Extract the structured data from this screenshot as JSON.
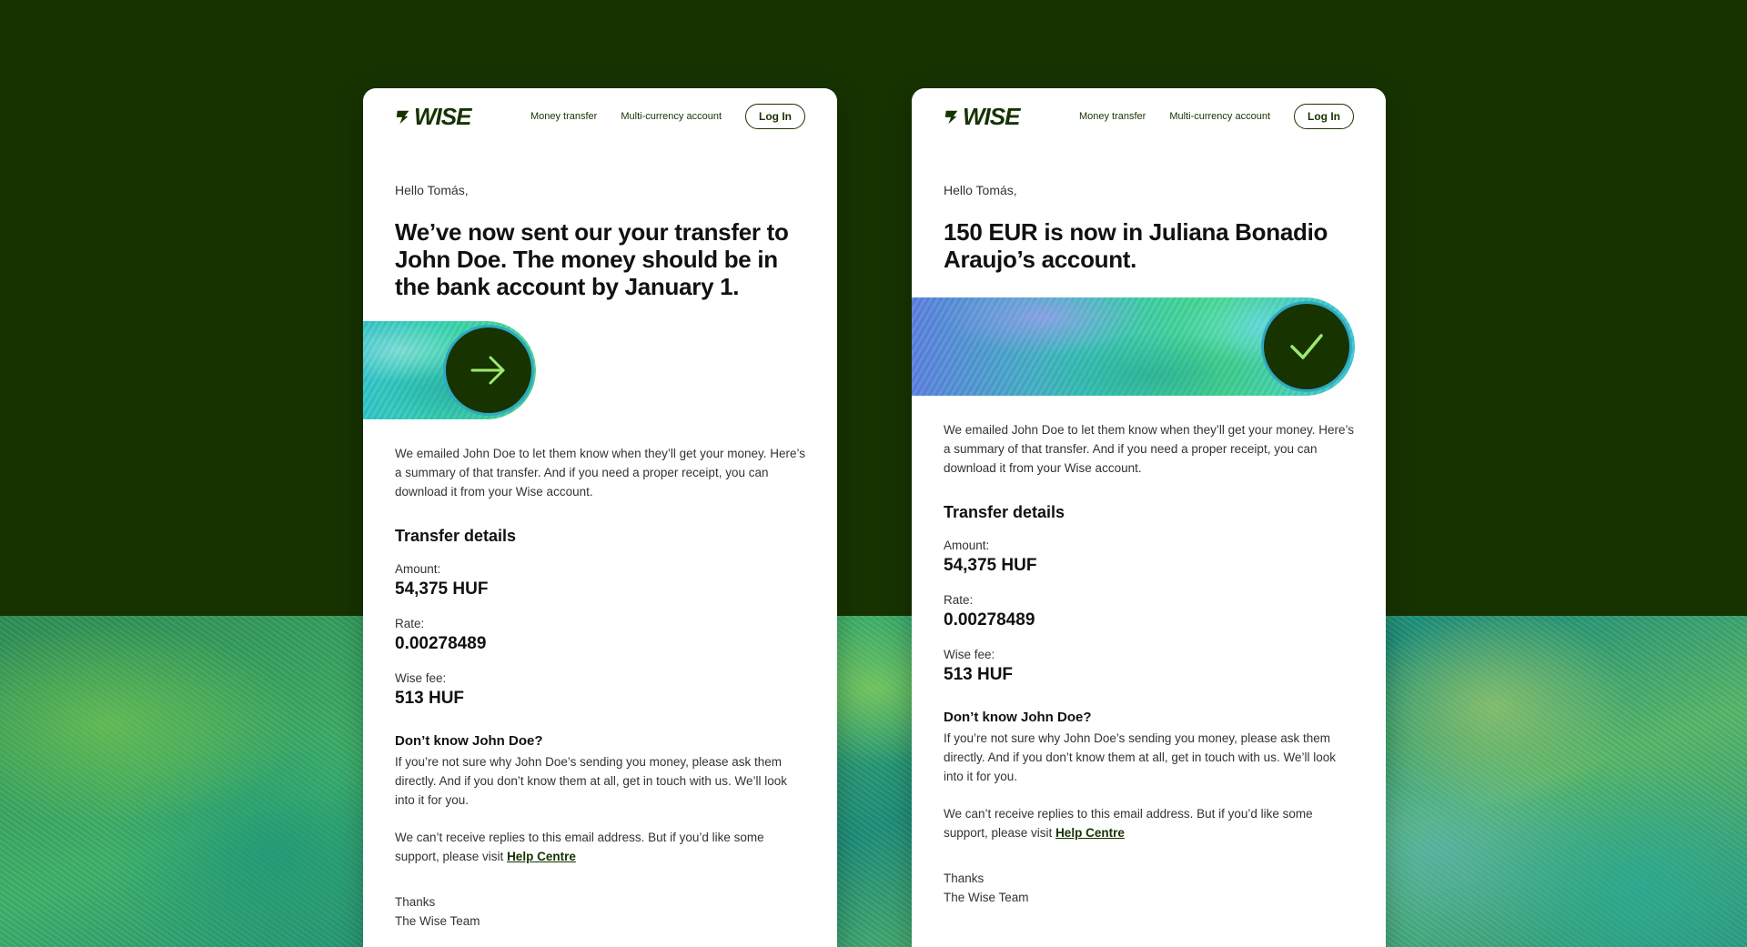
{
  "brand": {
    "logo_text": "WISE",
    "color": "#163300",
    "accent": "#9fe870"
  },
  "nav": {
    "links": [
      "Money transfer",
      "Multi-currency account"
    ],
    "login_label": "Log In"
  },
  "cards": [
    {
      "greeting": "Hello Tomás,",
      "headline": "We’ve now sent our your transfer to John Doe. The money should be in the bank account by January 1.",
      "status_icon": "arrow-right-icon",
      "intro": "We emailed John Doe to let them know when they’ll get your money. Here’s a summary of that transfer. And if you need a proper receipt, you can download it from your Wise account.",
      "details_title": "Transfer details",
      "details": [
        {
          "label": "Amount:",
          "value": "54,375 HUF"
        },
        {
          "label": "Rate:",
          "value": "0.00278489"
        },
        {
          "label": "Wise fee:",
          "value": "513 HUF"
        }
      ],
      "unknown_title": "Don’t know John Doe?",
      "unknown_text": "If you’re not sure why John Doe’s sending you money, please ask them directly. And if you don’t know them at all, get in touch with us. We’ll look into it for you.",
      "support_text": "We can’t receive replies to this email address. But if you’d like some support, please visit ",
      "support_link": "Help Centre",
      "thanks": "Thanks",
      "signature": "The Wise Team"
    },
    {
      "greeting": "Hello Tomás,",
      "headline": "150 EUR is now in Juliana Bonadio Araujo’s account.",
      "status_icon": "checkmark-icon",
      "intro": "We emailed John Doe to let them know when they’ll get your money. Here’s a summary of that transfer. And if you need a proper receipt, you can download it from your Wise account.",
      "details_title": "Transfer details",
      "details": [
        {
          "label": "Amount:",
          "value": "54,375 HUF"
        },
        {
          "label": "Rate:",
          "value": "0.00278489"
        },
        {
          "label": "Wise fee:",
          "value": "513 HUF"
        }
      ],
      "unknown_title": "Don’t know John Doe?",
      "unknown_text": "If you’re not sure why John Doe’s sending you money, please ask them directly. And if you don’t know them at all, get in touch with us. We’ll look into it for you.",
      "support_text": "We can’t receive replies to this email address. But if you’d like some support, please visit ",
      "support_link": "Help Centre",
      "thanks": "Thanks",
      "signature": "The Wise Team"
    }
  ]
}
